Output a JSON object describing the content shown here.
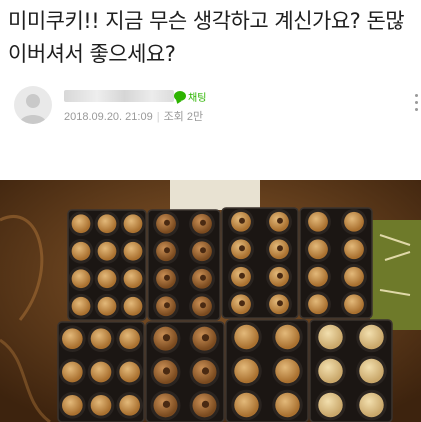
{
  "post": {
    "title": "미미쿠키!! 지금 무슨 생각하고 계신가요? 돈많이버셔서 좋으세요?",
    "author": {
      "nickname_censored": "",
      "chat_label": "채팅"
    },
    "date": "2018.09.20. 21:09",
    "views": "조회 2만"
  },
  "icons": [
    "avatar-icon",
    "chat-bubble-icon",
    "more-vert-icon"
  ],
  "colors": {
    "chat_green": "#2db400",
    "meta_gray": "#9a9a9a",
    "title": "#1e1e1e"
  }
}
